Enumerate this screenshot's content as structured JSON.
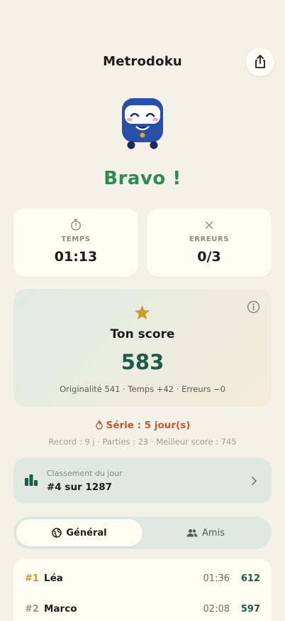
{
  "header": {
    "title": "Metrodoku"
  },
  "result": {
    "headline": "Bravo !"
  },
  "stats": [
    {
      "label": "TEMPS",
      "value": "01:13",
      "icon": "stopwatch-icon"
    },
    {
      "label": "ERREURS",
      "value": "0/3",
      "icon": "close-icon"
    }
  ],
  "score": {
    "title": "Ton score",
    "value": "583",
    "detail": "Originalité 541 · Temps +42 · Erreurs −0"
  },
  "streak": {
    "label": "Série : 5 jour(s)",
    "records": "Record : 9 j · Parties : 23 · Meilleur score : 745"
  },
  "ranking": {
    "subtitle": "Classement du jour",
    "position": "#4 sur 1287"
  },
  "tabs": [
    {
      "label": "Général",
      "active": true
    },
    {
      "label": "Amis",
      "active": false
    }
  ],
  "leaderboard": [
    {
      "rank": "#1",
      "name": "Léa",
      "time": "01:36",
      "score": "612",
      "rank_color": "#c99a2e"
    },
    {
      "rank": "#2",
      "name": "Marco",
      "time": "02:08",
      "score": "597",
      "rank_color": "#9a9890"
    }
  ],
  "colors": {
    "background": "#f4f1e8",
    "accent_green": "#2f8a55",
    "score_green": "#1e5b48",
    "streak_orange": "#c9552f",
    "star_gold": "#c99a2e"
  }
}
